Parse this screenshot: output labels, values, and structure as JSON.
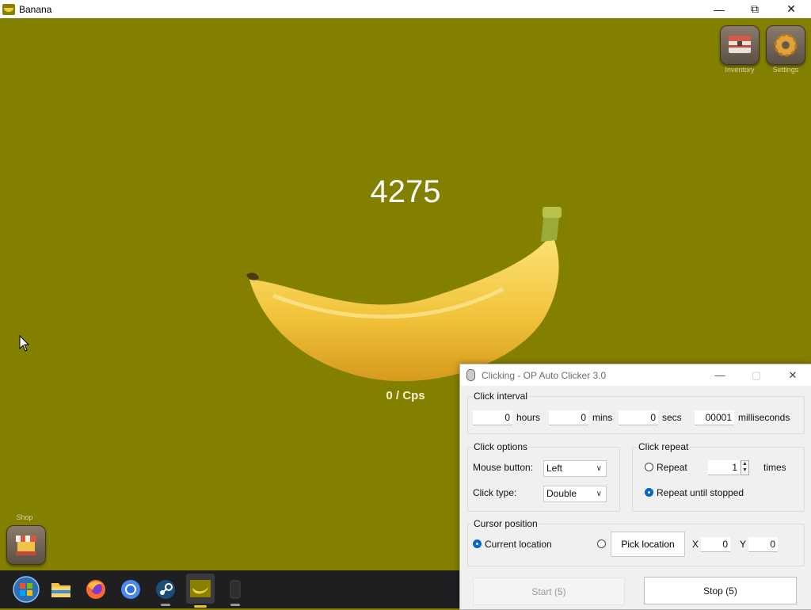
{
  "window": {
    "title": "Banana"
  },
  "game": {
    "count": "4275",
    "cps": "0 / Cps",
    "inventory_label": "Inventory",
    "settings_label": "Settings",
    "shop_label": "Shop"
  },
  "taskbar": {
    "apps": [
      "windows-start",
      "file-explorer",
      "firefox",
      "chrome",
      "steam",
      "banana",
      "unknown-app"
    ]
  },
  "clicker": {
    "title": "Clicking - OP Auto Clicker 3.0",
    "interval": {
      "label": "Click interval",
      "hours": "0",
      "hours_label": "hours",
      "mins": "0",
      "mins_label": "mins",
      "secs": "0",
      "secs_label": "secs",
      "ms": "00001",
      "ms_label": "milliseconds"
    },
    "options": {
      "label": "Click options",
      "mouse_button_label": "Mouse button:",
      "mouse_button": "Left",
      "click_type_label": "Click type:",
      "click_type": "Double"
    },
    "repeat": {
      "label": "Click repeat",
      "repeat_label": "Repeat",
      "times_value": "1",
      "times_label": "times",
      "until_stopped_label": "Repeat until stopped"
    },
    "cursor": {
      "label": "Cursor position",
      "current_label": "Current location",
      "pick_label": "Pick location",
      "x_label": "X",
      "x": "0",
      "y_label": "Y",
      "y": "0"
    },
    "start_label": "Start (5)",
    "stop_label": "Stop (5)"
  },
  "colors": {
    "background": "#838000",
    "accent": "#0068c8"
  }
}
